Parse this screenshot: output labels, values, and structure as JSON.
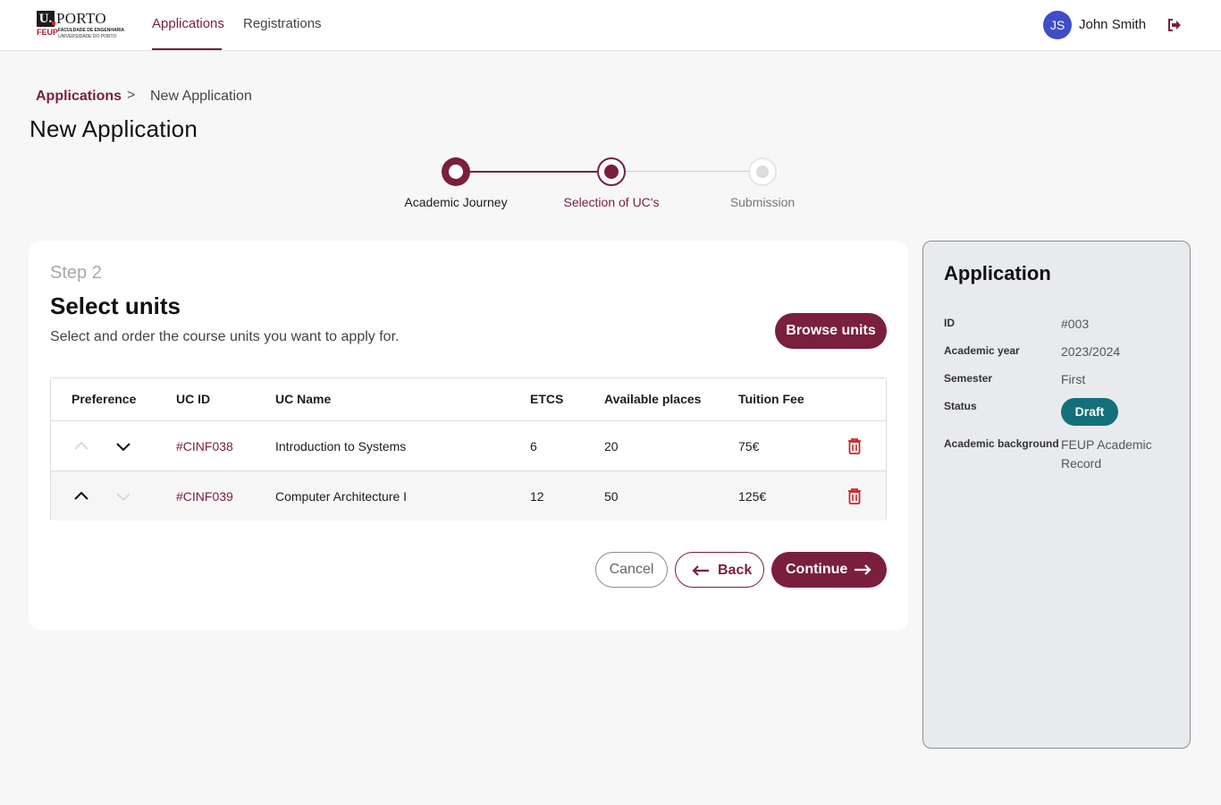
{
  "header": {
    "logo": {
      "mark": "U.",
      "name": "PORTO",
      "faculty_short": "FEUP",
      "faculty_line1": "FACULDADE DE ENGENHARIA",
      "faculty_line2": "UNIVERSIDADE DO PORTO"
    },
    "nav": [
      {
        "label": "Applications",
        "active": true
      },
      {
        "label": "Registrations",
        "active": false
      }
    ],
    "user": {
      "initials": "JS",
      "name": "John Smith",
      "avatar_color": "#3f4ec7"
    },
    "logout_icon": "logout-icon"
  },
  "breadcrumb": {
    "parent": "Applications",
    "separator": ">",
    "current": "New Application"
  },
  "page_title": "New Application",
  "stepper": {
    "steps": [
      {
        "label": "Academic Journey",
        "state": "completed"
      },
      {
        "label": "Selection of UC's",
        "state": "current"
      },
      {
        "label": "Submission",
        "state": "upcoming"
      }
    ]
  },
  "main": {
    "step_number": "Step 2",
    "title": "Select units",
    "description": "Select and order the course units you want to apply for.",
    "browse_label": "Browse units",
    "table": {
      "headers": [
        "Preference",
        "UC ID",
        "UC Name",
        "ETCS",
        "Available places",
        "Tuition Fee"
      ],
      "rows": [
        {
          "uc_id": "#CINF038",
          "uc_name": "Introduction to Systems",
          "etcs": "6",
          "places": "20",
          "fee": "75€",
          "can_move_up": false,
          "can_move_down": true
        },
        {
          "uc_id": "#CINF039",
          "uc_name": "Computer Architecture I",
          "etcs": "12",
          "places": "50",
          "fee": "125€",
          "can_move_up": true,
          "can_move_down": false
        }
      ]
    },
    "actions": {
      "cancel": "Cancel",
      "back": "Back",
      "continue": "Continue"
    }
  },
  "application_panel": {
    "title": "Application",
    "fields": [
      {
        "key": "ID",
        "value": "#003"
      },
      {
        "key": "Academic year",
        "value": "2023/2024"
      },
      {
        "key": "Semester",
        "value": "First"
      },
      {
        "key": "Status",
        "value": "Draft"
      },
      {
        "key": "Academic background",
        "value": "FEUP Academic Record"
      }
    ],
    "status_color": "#13707a"
  },
  "colors": {
    "brand": "#7a1f3d",
    "status": "#13707a",
    "danger": "#c62828"
  }
}
